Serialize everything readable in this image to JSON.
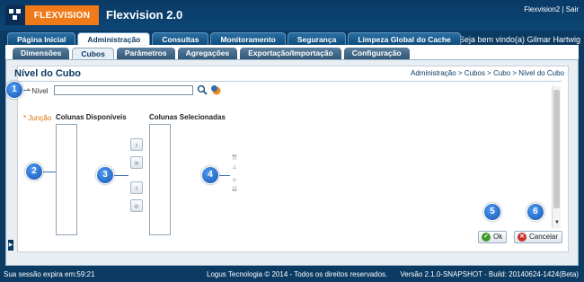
{
  "header": {
    "logo_text": "FLEXVISION",
    "app_title": "Flexvision 2.0",
    "user": "Flexvision2",
    "separator": "|",
    "logout": "Sair",
    "welcome": "Seja bem vindo(a) Gilmar Hartwig"
  },
  "main_tabs": [
    {
      "label": "Página Inicial"
    },
    {
      "label": "Administração"
    },
    {
      "label": "Consultas"
    },
    {
      "label": "Monitoramento"
    },
    {
      "label": "Segurança"
    },
    {
      "label": "Limpeza Global do Cache"
    }
  ],
  "sub_tabs": [
    {
      "label": "Dimensões"
    },
    {
      "label": "Cubos"
    },
    {
      "label": "Parâmetros"
    },
    {
      "label": "Agregações"
    },
    {
      "label": "Exportação/Importação"
    },
    {
      "label": "Configuração"
    }
  ],
  "page": {
    "title": "Nível do Cubo",
    "breadcrumb": "Administração > Cubos > Cubo > Nível do Cubo"
  },
  "form": {
    "required_mark": "*",
    "nivel_label": "Nível",
    "nivel_value": "",
    "juncao_label": "Junção",
    "available_label": "Colunas Disponíveis",
    "selected_label": "Colunas Selecionadas"
  },
  "shuttle": {
    "move": "›",
    "move_all": "»",
    "remove": "‹",
    "remove_all": "«"
  },
  "reorder": {
    "top": "⇈",
    "up": "▵",
    "down": "▿",
    "bottom": "⇊"
  },
  "callouts": [
    "1",
    "2",
    "3",
    "4",
    "5",
    "6"
  ],
  "buttons": {
    "ok": "Ok",
    "cancel": "Cancelar"
  },
  "footer": {
    "session": "Sua sessão expira em:59:21",
    "copyright": "Logus Tecnologia © 2014 - Todos os direitos reservados.",
    "version": "Versão 2.1.0-SNAPSHOT - Build: 20140624-1424(Beta)"
  }
}
